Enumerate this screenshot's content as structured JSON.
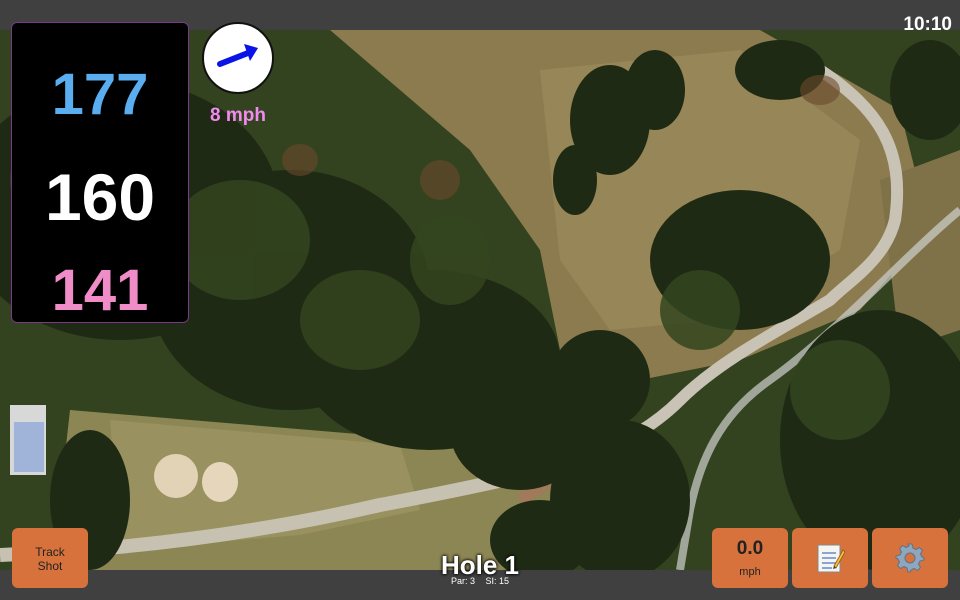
{
  "status_bar": {
    "time": "10:10"
  },
  "distances": {
    "back": "177",
    "middle": "160",
    "front": "141"
  },
  "wind": {
    "speed_label": "8 mph",
    "icon": "arrow-right-icon"
  },
  "hole": {
    "title": "Hole 1",
    "par_label": "Par: 3",
    "si_label": "SI: 15"
  },
  "buttons": {
    "track_shot_line1": "Track",
    "track_shot_line2": "Shot",
    "speed_value": "0.0",
    "speed_unit": "mph",
    "notes_icon": "notepad-icon",
    "settings_icon": "gear-icon"
  },
  "colors": {
    "back_distance": "#5aaef0",
    "middle_distance": "#ffffff",
    "front_distance": "#f08cc8",
    "wind_speed": "#f08cf0",
    "button_bg": "#d7723c"
  }
}
